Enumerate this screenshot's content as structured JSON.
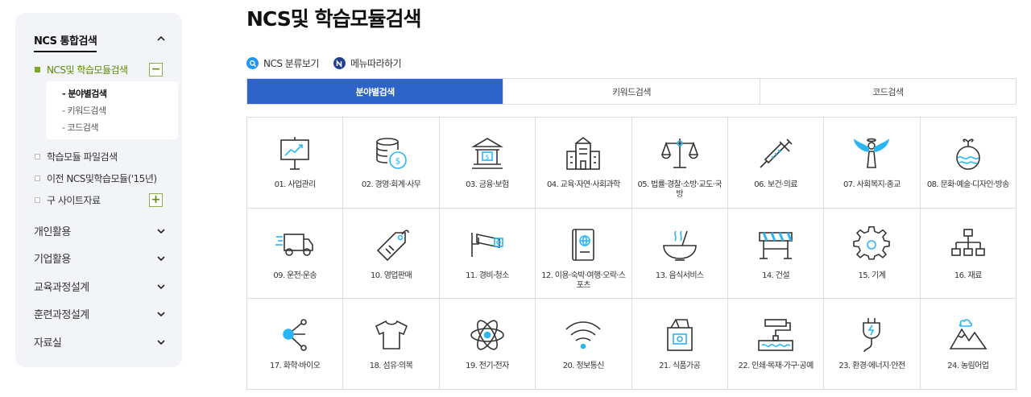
{
  "sidebar": {
    "heading": "NCS 통합검색",
    "items": [
      {
        "label": "NCS및 학습모듈검색",
        "toggle": "−"
      },
      {
        "label": "학습모듈 파일검색"
      },
      {
        "label": "이전 NCS및학습모듈('15년)"
      },
      {
        "label": "구 사이트자료",
        "toggle": "+"
      }
    ],
    "sub_items": [
      "분야별검색",
      "키워드검색",
      "코드검색"
    ],
    "sub_prefix": "-",
    "sections": [
      "개인활용",
      "기업활용",
      "교육과정설계",
      "훈련과정설계",
      "자료실"
    ]
  },
  "main": {
    "title": "NCS및 학습모듈검색",
    "links": [
      {
        "label": "NCS 분류보기",
        "icon": "magnifier-icon",
        "color": "#2196f3"
      },
      {
        "label": "메뉴따라하기",
        "icon": "n-logo-icon",
        "color": "#1f3f8f"
      }
    ],
    "tabs": [
      "분야별검색",
      "키워드검색",
      "코드검색"
    ],
    "active_tab": 0,
    "accent": "#2e64c9",
    "categories": [
      {
        "label": "01. 사업관리",
        "icon": "presentation-board-icon"
      },
      {
        "label": "02. 경영·회계·사무",
        "icon": "coins-dollar-icon"
      },
      {
        "label": "03. 금융·보험",
        "icon": "bank-building-icon"
      },
      {
        "label": "04. 교육·자연·사회과학",
        "icon": "school-building-icon"
      },
      {
        "label": "05. 법률·경찰·소방·교도·국방",
        "icon": "scales-icon"
      },
      {
        "label": "06. 보건·의료",
        "icon": "syringe-icon"
      },
      {
        "label": "07. 사회복지·종교",
        "icon": "angel-icon"
      },
      {
        "label": "08. 문화·예술·디자인·방송",
        "icon": "ornament-icon"
      },
      {
        "label": "09. 운전·운송",
        "icon": "truck-icon"
      },
      {
        "label": "10. 영업판매",
        "icon": "price-tag-icon"
      },
      {
        "label": "11. 경비·청소",
        "icon": "cctv-camera-icon"
      },
      {
        "label": "12. 이용·숙박·여행·오락·스포츠",
        "icon": "passport-icon"
      },
      {
        "label": "13. 음식서비스",
        "icon": "steaming-bowl-icon"
      },
      {
        "label": "14. 건설",
        "icon": "road-barrier-icon"
      },
      {
        "label": "15. 기계",
        "icon": "gear-icon"
      },
      {
        "label": "16. 재료",
        "icon": "hierarchy-icon"
      },
      {
        "label": "17. 화학·바이오",
        "icon": "molecule-icon"
      },
      {
        "label": "18. 섬유·의복",
        "icon": "t-shirt-icon"
      },
      {
        "label": "19. 전기·전자",
        "icon": "atom-icon"
      },
      {
        "label": "20. 정보통신",
        "icon": "wifi-icon"
      },
      {
        "label": "21. 식품가공",
        "icon": "milk-carton-icon"
      },
      {
        "label": "22. 인쇄·목재·가구·공예",
        "icon": "paint-roller-icon"
      },
      {
        "label": "23. 환경·에너지·안전",
        "icon": "power-plug-icon"
      },
      {
        "label": "24. 농림어업",
        "icon": "mountains-icon"
      }
    ]
  }
}
